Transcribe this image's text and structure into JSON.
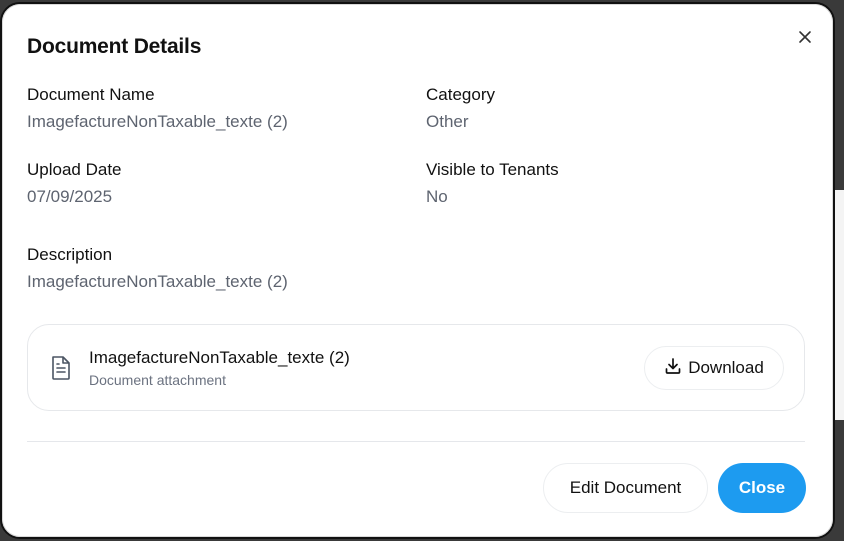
{
  "dialog": {
    "title": "Document Details",
    "fields": {
      "document_name_label": "Document Name",
      "document_name_value": "ImagefactureNonTaxable_texte (2)",
      "category_label": "Category",
      "category_value": "Other",
      "upload_date_label": "Upload Date",
      "upload_date_value": "07/09/2025",
      "visible_label": "Visible to Tenants",
      "visible_value": "No",
      "description_label": "Description",
      "description_value": "ImagefactureNonTaxable_texte (2)"
    },
    "attachment": {
      "name": "ImagefactureNonTaxable_texte (2)",
      "subtitle": "Document attachment",
      "icon": "file-text-icon",
      "download_label": "Download",
      "download_icon": "download-icon"
    },
    "footer": {
      "edit_label": "Edit Document",
      "close_label": "Close"
    },
    "close_icon": "close-icon"
  },
  "colors": {
    "primary": "#1d9bf0",
    "muted_text": "#5e6470",
    "border": "#e6e8eb"
  }
}
